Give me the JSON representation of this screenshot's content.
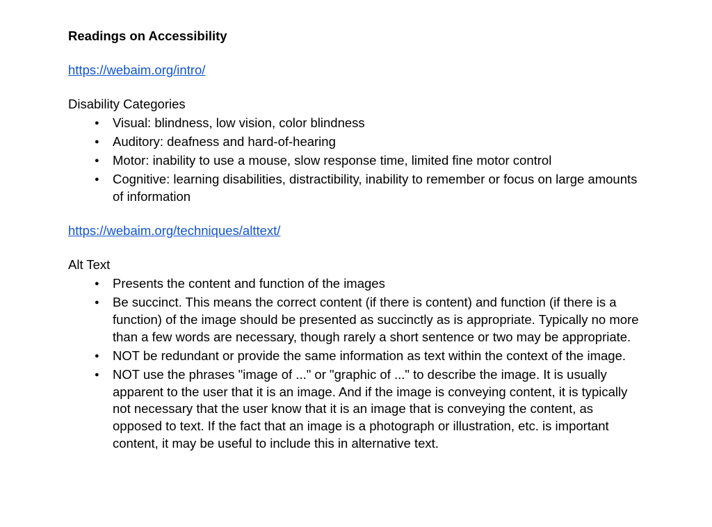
{
  "title": "Readings on Accessibility",
  "link1": "https://webaim.org/intro/",
  "section1": {
    "header": "Disability Categories",
    "items": [
      "Visual: blindness, low vision, color blindness",
      "Auditory: deafness and hard-of-hearing",
      "Motor: inability to use a mouse, slow response time, limited fine motor control",
      "Cognitive: learning disabilities, distractibility, inability to remember or focus on large amounts of information"
    ]
  },
  "link2": "https://webaim.org/techniques/alttext/",
  "section2": {
    "header": "Alt Text",
    "items": [
      "Presents the content and function of the images",
      "Be succinct. This means the correct content (if there is content) and function (if there is a function) of the image should be presented as succinctly as is appropriate. Typically no more than a few words are necessary, though rarely a short sentence or two may be appropriate.",
      "NOT be redundant or provide the same information as text within the context of the image.",
      "NOT use the phrases \"image of ...\" or \"graphic of ...\" to describe the image. It is usually apparent to the user that it is an image. And if the image is conveying content, it is typically not necessary that the user know that it is an image that is conveying the content, as opposed to text. If the fact that an image is a photograph or illustration, etc. is important content, it may be useful to include this in alternative text."
    ]
  }
}
